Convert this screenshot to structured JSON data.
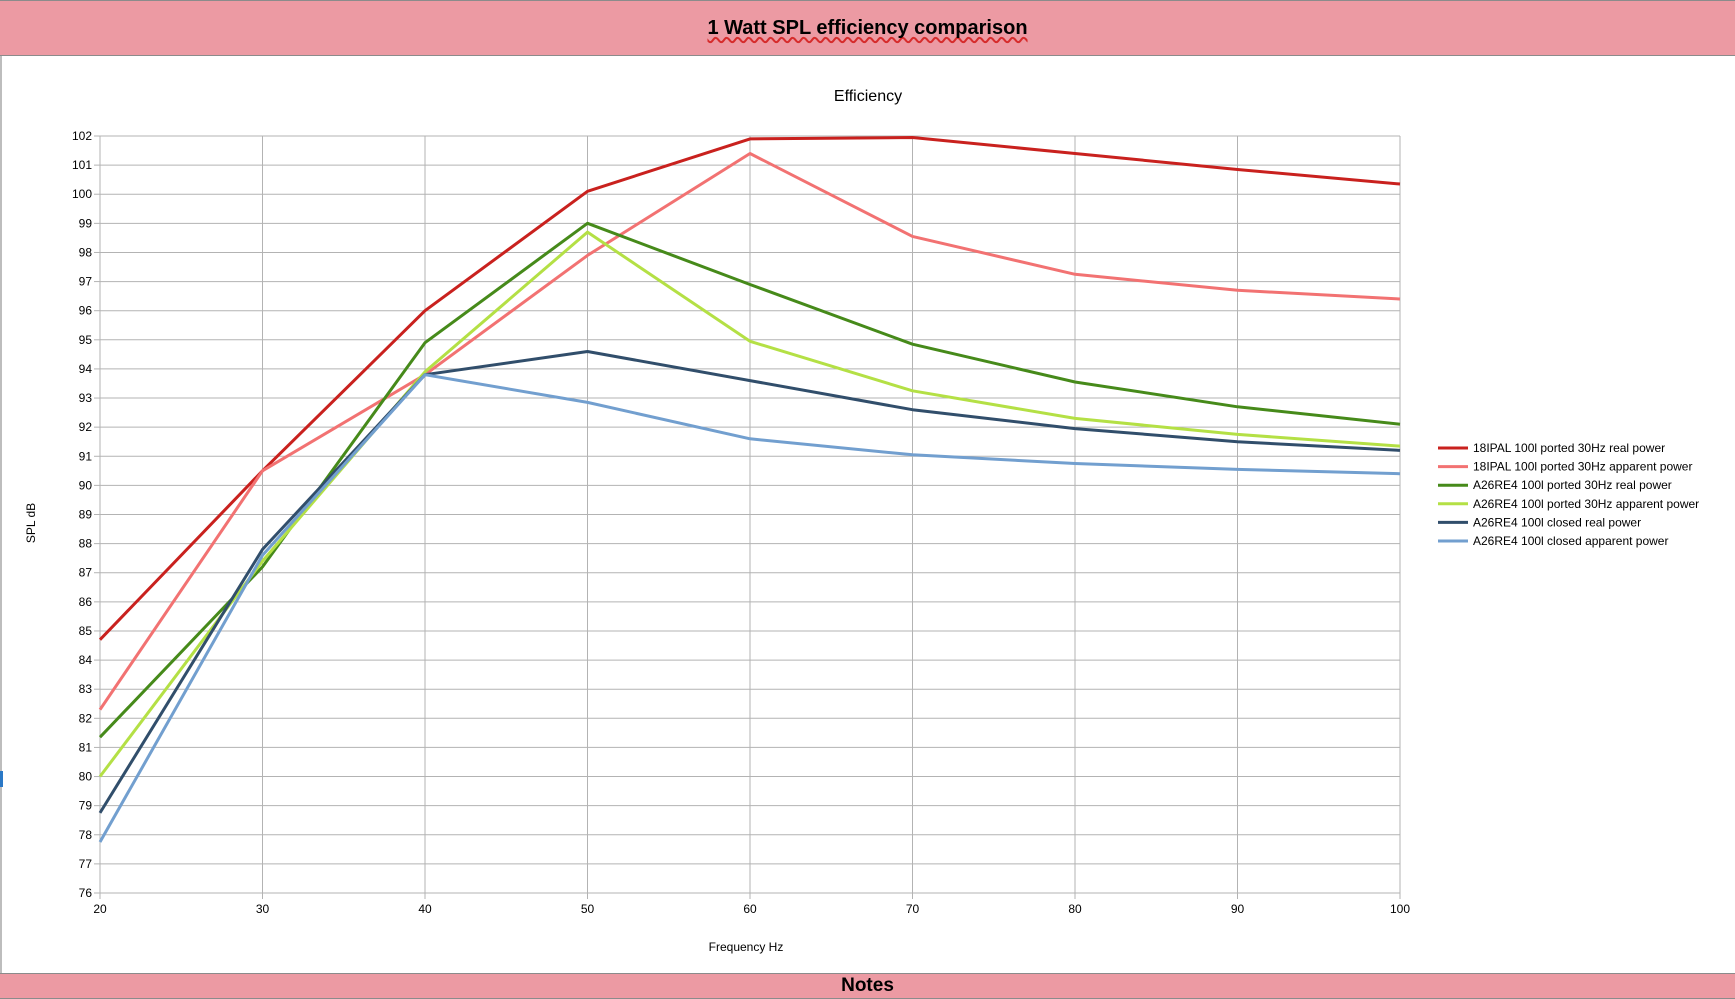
{
  "header": {
    "title": "1 Watt SPL efficiency comparison"
  },
  "footer": {
    "notes_label": "Notes"
  },
  "chart_data": {
    "type": "line",
    "title": "Efficiency",
    "xlabel": "Frequency Hz",
    "ylabel": "SPL dB",
    "xlim": [
      20,
      100
    ],
    "ylim": [
      76,
      102
    ],
    "xticks": [
      20,
      30,
      40,
      50,
      60,
      70,
      80,
      90,
      100
    ],
    "yticks": [
      76,
      77,
      78,
      79,
      80,
      81,
      82,
      83,
      84,
      85,
      86,
      87,
      88,
      89,
      90,
      91,
      92,
      93,
      94,
      95,
      96,
      97,
      98,
      99,
      100,
      101,
      102
    ],
    "grid": true,
    "legend_position": "right",
    "x": [
      20,
      30,
      40,
      50,
      60,
      70,
      80,
      90,
      100
    ],
    "series": [
      {
        "name": "18IPAL 100l ported 30Hz real power",
        "color": "#c9211e",
        "values": [
          84.7,
          90.5,
          96.0,
          100.1,
          101.9,
          101.95,
          101.4,
          100.85,
          100.35
        ]
      },
      {
        "name": "18IPAL 100l ported 30Hz apparent power",
        "color": "#f27272",
        "values": [
          82.3,
          90.5,
          93.8,
          97.9,
          101.4,
          98.55,
          97.25,
          96.7,
          96.4
        ]
      },
      {
        "name": "A26RE4 100l ported 30Hz real power",
        "color": "#468a1a",
        "values": [
          81.35,
          87.2,
          94.9,
          99.0,
          96.9,
          94.85,
          93.55,
          92.7,
          92.1
        ]
      },
      {
        "name": "A26RE4 100l ported 30Hz apparent power",
        "color": "#b4e045",
        "values": [
          80.0,
          87.4,
          93.9,
          98.7,
          94.95,
          93.25,
          92.3,
          91.75,
          91.35
        ]
      },
      {
        "name": "A26RE4 100l closed real power",
        "color": "#314e6b",
        "values": [
          78.75,
          87.8,
          93.8,
          94.6,
          93.6,
          92.6,
          91.95,
          91.5,
          91.2
        ]
      },
      {
        "name": "A26RE4 100l closed apparent power",
        "color": "#729fcf",
        "values": [
          77.75,
          87.6,
          93.8,
          92.85,
          91.6,
          91.05,
          90.75,
          90.55,
          90.4
        ]
      }
    ]
  }
}
